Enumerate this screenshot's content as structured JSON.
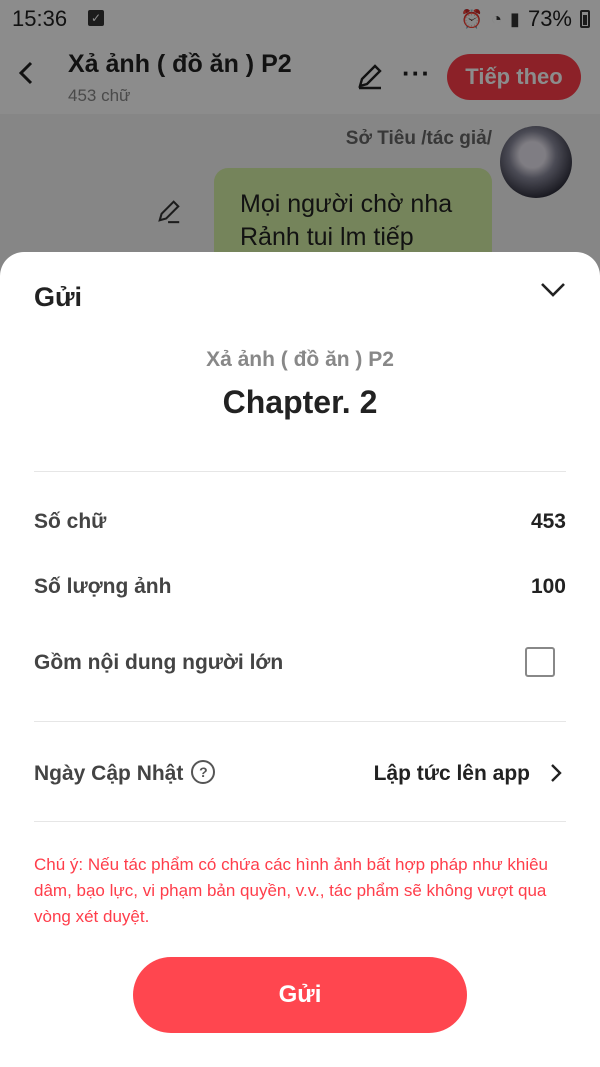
{
  "status_bar": {
    "time": "15:36",
    "battery": "73%",
    "icons": [
      "check-icon",
      "alarm-icon",
      "wifi-icon",
      "signal-icon",
      "battery-icon"
    ]
  },
  "header": {
    "title": "Xả ảnh ( đồ ăn ) P2",
    "subtitle": "453 chữ",
    "next_label": "Tiếp theo",
    "more_label": "···"
  },
  "chat": {
    "author": "Sở Tiêu /tác giả/",
    "message_line1": "Mọi người chờ nha",
    "message_line2": "Rảnh tui lm tiếp"
  },
  "sheet": {
    "title": "Gửi",
    "work_title": "Xả ảnh ( đồ ăn ) P2",
    "chapter": "Chapter. 2",
    "word_count_label": "Số chữ",
    "word_count_value": "453",
    "image_count_label": "Số lượng ảnh",
    "image_count_value": "100",
    "adult_label": "Gồm nội dung người lớn",
    "adult_checked": false,
    "update_label": "Ngày Cập Nhật",
    "help_glyph": "?",
    "update_value": "Lập tức lên app",
    "note": "Chú ý: Nếu tác phẩm có chứa các hình ảnh bất hợp pháp như khiêu dâm, bạo lực, vi phạm bản quyền, v.v., tác phẩm sẽ không vượt qua vòng xét duyệt.",
    "submit_label": "Gửi"
  },
  "colors": {
    "accent": "#ff3d4a",
    "bubble": "#d6f0a6",
    "note": "#ff3d4a"
  }
}
